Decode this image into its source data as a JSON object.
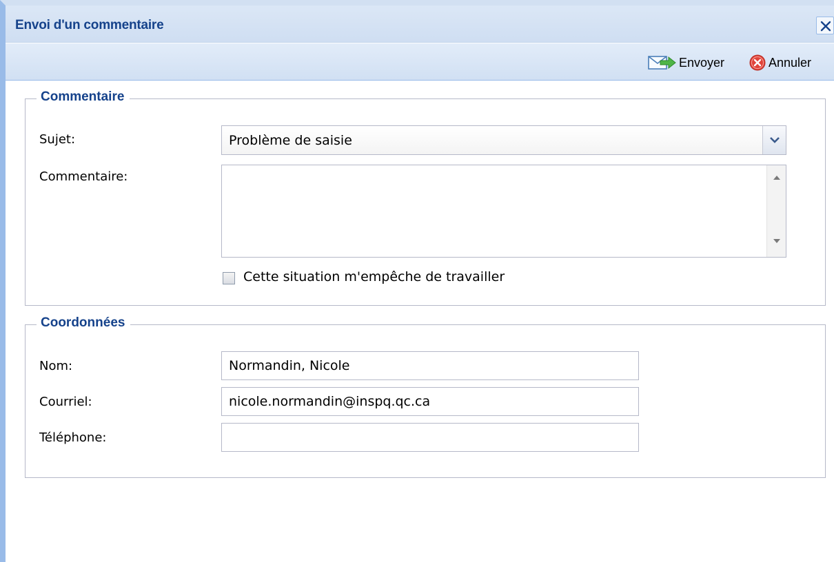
{
  "window": {
    "title": "Envoi d'un commentaire"
  },
  "toolbar": {
    "send_label": "Envoyer",
    "cancel_label": "Annuler"
  },
  "comment_section": {
    "legend": "Commentaire",
    "subject_label": "Sujet:",
    "subject_value": "Problème de saisie",
    "comment_label": "Commentaire:",
    "comment_value": "",
    "blocking_checkbox_label": "Cette situation m'empêche de travailler",
    "blocking_checked": false
  },
  "contact_section": {
    "legend": "Coordonnées",
    "name_label": "Nom:",
    "name_value": "Normandin, Nicole",
    "email_label": "Courriel:",
    "email_value": "nicole.normandin@inspq.qc.ca",
    "phone_label": "Téléphone:",
    "phone_value": ""
  },
  "icons": {
    "close": "close-icon",
    "send": "envelope-send-icon",
    "cancel": "cancel-circle-icon",
    "dropdown": "chevron-down-icon"
  },
  "colors": {
    "title_blue": "#15428b",
    "header_bg": "#d1e0f3",
    "border": "#99bbe8",
    "cancel_red": "#e0443a"
  }
}
